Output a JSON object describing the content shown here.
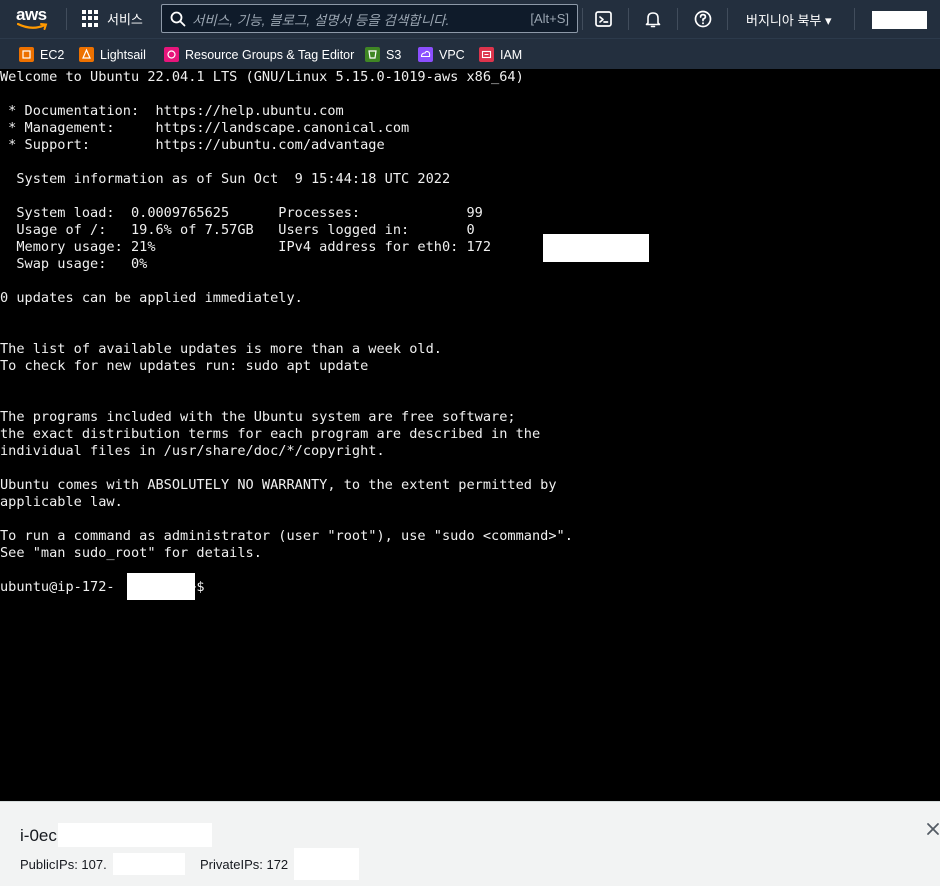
{
  "nav": {
    "logo_text": "aws",
    "services_label": "서비스",
    "search_placeholder": "서비스, 기능, 블로그, 설명서 등을 검색합니다.",
    "search_shortcut": "[Alt+S]",
    "region_label": "버지니아 북부 ▾"
  },
  "favorites": [
    {
      "label": "EC2",
      "color": "#ed7100"
    },
    {
      "label": "Lightsail",
      "color": "#ed7100"
    },
    {
      "label": "Resource Groups & Tag Editor",
      "color": "#e7157b"
    },
    {
      "label": "S3",
      "color": "#3f8624"
    },
    {
      "label": "VPC",
      "color": "#8c4fff"
    },
    {
      "label": "IAM",
      "color": "#dd344c"
    }
  ],
  "terminal": {
    "lines": [
      "Welcome to Ubuntu 22.04.1 LTS (GNU/Linux 5.15.0-1019-aws x86_64)",
      "",
      " * Documentation:  https://help.ubuntu.com",
      " * Management:     https://landscape.canonical.com",
      " * Support:        https://ubuntu.com/advantage",
      "",
      "  System information as of Sun Oct  9 15:44:18 UTC 2022",
      "",
      "  System load:  0.0009765625      Processes:             99",
      "  Usage of /:   19.6% of 7.57GB   Users logged in:       0",
      "  Memory usage: 21%               IPv4 address for eth0: 172",
      "  Swap usage:   0%",
      "",
      "0 updates can be applied immediately.",
      "",
      "",
      "The list of available updates is more than a week old.",
      "To check for new updates run: sudo apt update",
      "",
      "",
      "The programs included with the Ubuntu system are free software;",
      "the exact distribution terms for each program are described in the",
      "individual files in /usr/share/doc/*/copyright.",
      "",
      "Ubuntu comes with ABSOLUTELY NO WARRANTY, to the extent permitted by",
      "applicable law.",
      "",
      "To run a command as administrator (user \"root\"), use \"sudo <command>\".",
      "See \"man sudo_root\" for details.",
      "",
      "ubuntu@ip-172-        :~$"
    ]
  },
  "panel": {
    "instance_id": "i-0ec",
    "public_ip_label": "PublicIPs: 107.",
    "private_ip_label": "PrivateIPs: 172"
  },
  "colors": {
    "nav_bg": "#232f3e",
    "terminal_bg": "#000000",
    "terminal_fg": "#f0f0f0",
    "panel_bg": "#f2f3f3"
  }
}
